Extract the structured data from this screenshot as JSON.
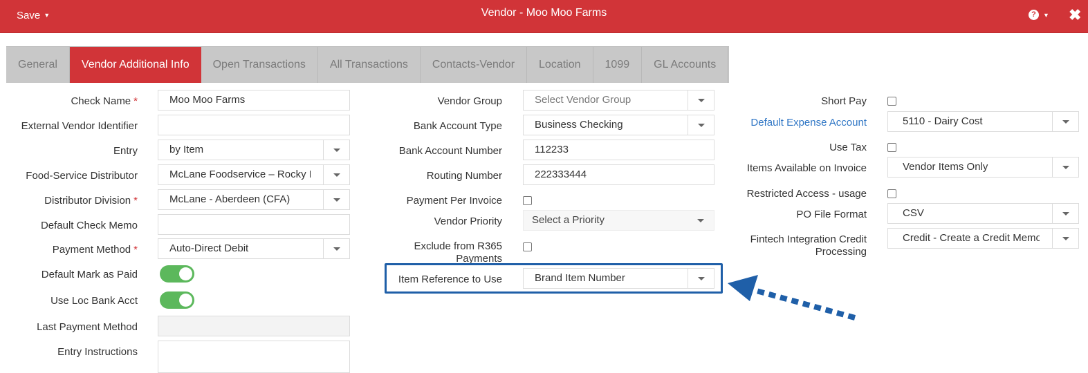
{
  "header": {
    "save_label": "Save",
    "title": "Vendor - Moo Moo Farms",
    "help_icon": "?",
    "close_icon": "✖"
  },
  "tabs": [
    {
      "label": "General",
      "active": false
    },
    {
      "label": "Vendor Additional Info",
      "active": true
    },
    {
      "label": "Open Transactions",
      "active": false
    },
    {
      "label": "All Transactions",
      "active": false
    },
    {
      "label": "Contacts-Vendor",
      "active": false
    },
    {
      "label": "Location",
      "active": false
    },
    {
      "label": "1099",
      "active": false
    },
    {
      "label": "GL Accounts",
      "active": false
    }
  ],
  "left": {
    "check_name": {
      "label": "Check Name",
      "value": "Moo Moo Farms"
    },
    "external_vendor_identifier": {
      "label": "External Vendor Identifier",
      "value": ""
    },
    "entry": {
      "label": "Entry",
      "value": "by Item"
    },
    "food_service_distributor": {
      "label": "Food-Service Distributor",
      "value": "McLane Foodservice – Rocky Mountain"
    },
    "distributor_division": {
      "label": "Distributor Division",
      "value": "McLane - Aberdeen (CFA)"
    },
    "default_check_memo": {
      "label": "Default Check Memo",
      "value": ""
    },
    "payment_method": {
      "label": "Payment Method",
      "value": "Auto-Direct Debit"
    },
    "default_mark_as_paid": {
      "label": "Default Mark as Paid",
      "on": true
    },
    "use_loc_bank_acct": {
      "label": "Use Loc Bank Acct",
      "on": true
    },
    "last_payment_method": {
      "label": "Last Payment Method",
      "value": ""
    },
    "entry_instructions": {
      "label": "Entry Instructions",
      "value": ""
    },
    "required_marker": "*"
  },
  "middle": {
    "vendor_group": {
      "label": "Vendor Group",
      "placeholder": "Select Vendor Group"
    },
    "bank_account_type": {
      "label": "Bank Account Type",
      "value": "Business Checking"
    },
    "bank_account_number": {
      "label": "Bank Account Number",
      "value": "112233"
    },
    "routing_number": {
      "label": "Routing Number",
      "value": "222333444"
    },
    "payment_per_invoice": {
      "label": "Payment Per Invoice",
      "checked": false
    },
    "vendor_priority": {
      "label": "Vendor Priority",
      "placeholder": "Select a Priority"
    },
    "exclude_from_r365": {
      "label_line1": "Exclude from R365",
      "label_line2": "Payments",
      "checked": false
    },
    "item_reference": {
      "label": "Item Reference to Use",
      "value": "Brand Item Number"
    }
  },
  "right": {
    "short_pay": {
      "label": "Short Pay",
      "checked": false
    },
    "default_expense_account": {
      "label": "Default Expense Account",
      "value": "5110 - Dairy Cost"
    },
    "use_tax": {
      "label": "Use Tax",
      "checked": false
    },
    "items_available_on_invoice": {
      "label": "Items Available on Invoice",
      "value": "Vendor Items Only"
    },
    "restricted_access": {
      "label": "Restricted Access - usage",
      "checked": false
    },
    "po_file_format": {
      "label": "PO File Format",
      "value": "CSV"
    },
    "fintech_integration": {
      "label_line1": "Fintech Integration Credit",
      "label_line2": "Processing",
      "value": "Credit - Create a Credit Memo"
    }
  },
  "colors": {
    "brand_red": "#d13438",
    "toggle_green": "#5cb85c",
    "highlight_blue": "#1f5fa8",
    "link_blue": "#2f76c5"
  }
}
